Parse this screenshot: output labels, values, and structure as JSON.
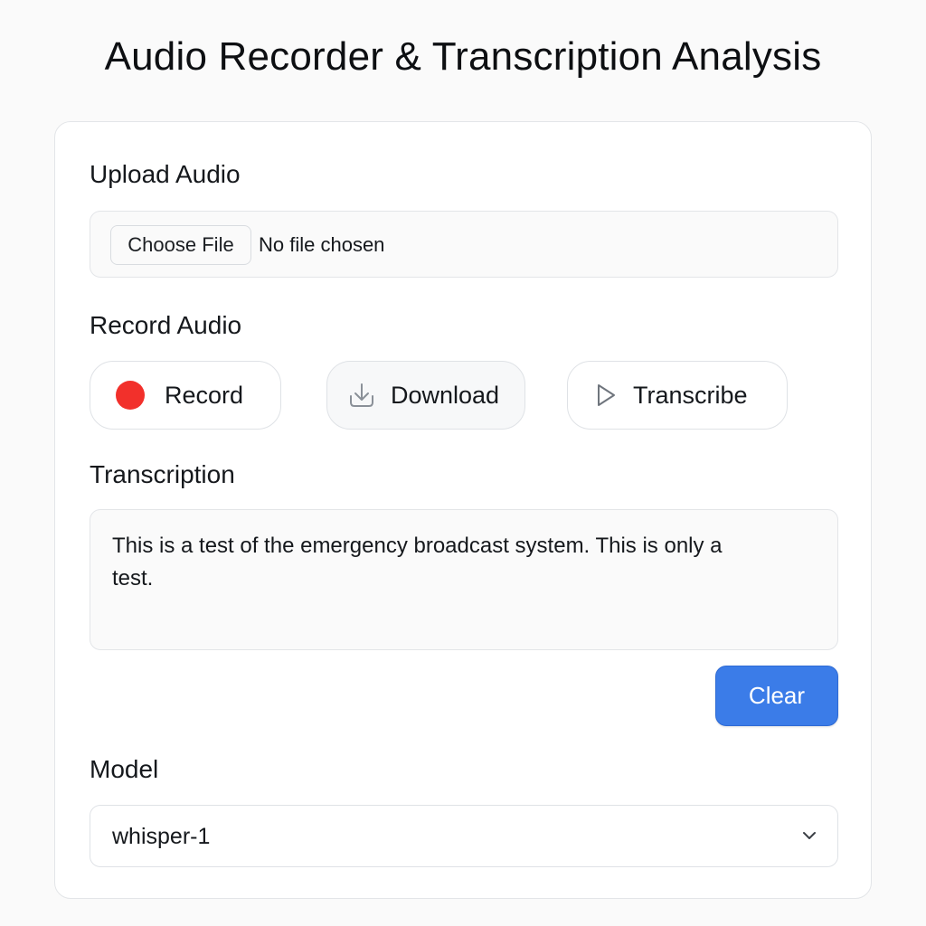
{
  "header": {
    "title": "Audio Recorder & Transcription Analysis"
  },
  "upload": {
    "label": "Upload Audio",
    "choose_button": "Choose File",
    "status": "No file chosen"
  },
  "record": {
    "label": "Record Audio",
    "buttons": [
      {
        "label": "Record",
        "icon": "record-dot-icon"
      },
      {
        "label": "Download",
        "icon": "download-icon"
      },
      {
        "label": "Transcribe",
        "icon": "play-icon"
      }
    ]
  },
  "transcription": {
    "label": "Transcription",
    "text": "This is a test of the emergency broadcast system. This is only a test.",
    "clear_button": "Clear"
  },
  "model": {
    "label": "Model",
    "selected": "whisper-1",
    "icon": "chevron-down-icon"
  },
  "colors": {
    "accent": "#3b7ce8",
    "record": "#f2302b"
  }
}
